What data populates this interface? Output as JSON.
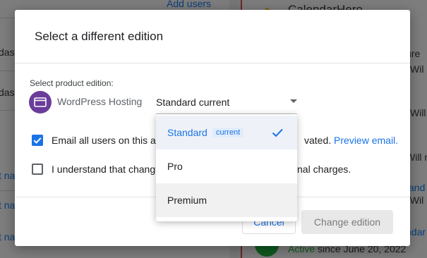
{
  "background": {
    "left_link": "Add users",
    "left_fragments": [
      "dast",
      "das",
      "t na",
      "t na",
      "t na"
    ],
    "app_name": "CalendarHero",
    "right_fragments": [
      "ure",
      "Wil",
      "Will",
      "Will re",
      "and",
      ". Wil",
      "ndar"
    ],
    "status_active": "Active",
    "status_since": " since June 20, 2022"
  },
  "modal": {
    "title": "Select a different edition",
    "field_label": "Select product edition:",
    "product_icon": "browser-window-icon",
    "product_name": "WordPress Hosting",
    "select_value": "Standard current",
    "email_checkbox": {
      "checked": true,
      "text_before": "Email all users on this a",
      "text_after": "vated.",
      "link": "Preview email."
    },
    "understand_checkbox": {
      "checked": false,
      "text_before": "I understand that chang",
      "text_after": "nal charges."
    },
    "cancel_label": "Cancel",
    "change_label": "Change edition"
  },
  "dropdown": {
    "options": [
      {
        "label": "Standard",
        "badge": "current",
        "selected": true
      },
      {
        "label": "Pro"
      },
      {
        "label": "Premium"
      }
    ],
    "check_icon": "checkmark-icon"
  },
  "colors": {
    "accent": "#1a73e8",
    "product_icon_bg": "#6a3d9a"
  }
}
